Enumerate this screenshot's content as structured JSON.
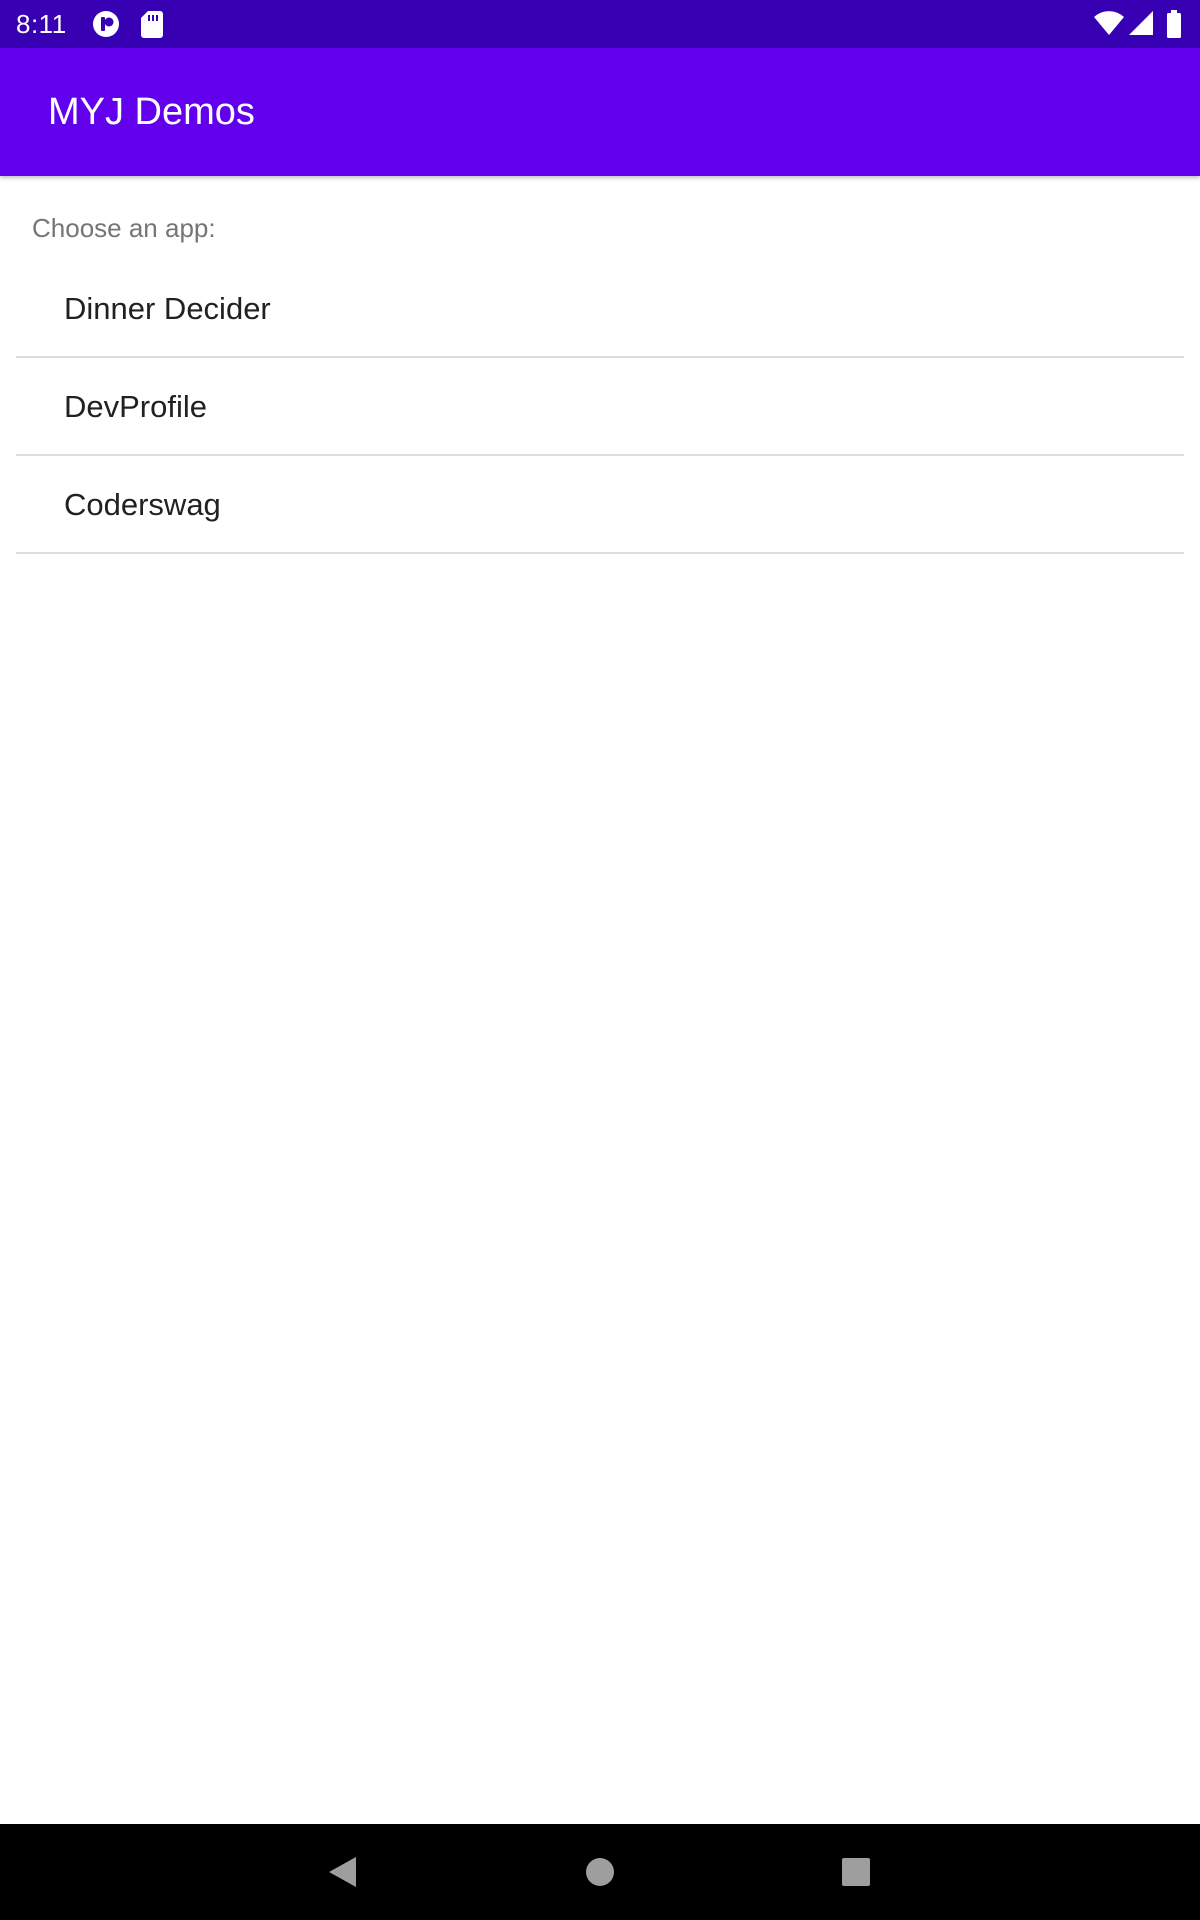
{
  "status_bar": {
    "time": "8:11",
    "color": "#3700b3",
    "left_icons": [
      "notification-app-icon",
      "sd-card-icon"
    ],
    "right_icons": [
      "wifi-icon",
      "cell-signal-icon",
      "battery-icon"
    ]
  },
  "app_bar": {
    "title": "MYJ Demos",
    "color": "#6200ee"
  },
  "content": {
    "header": "Choose an app:",
    "apps": [
      {
        "label": "Dinner Decider"
      },
      {
        "label": "DevProfile"
      },
      {
        "label": "Coderswag"
      }
    ]
  },
  "nav_bar": {
    "buttons": [
      "back-icon",
      "home-icon",
      "recents-icon"
    ]
  }
}
